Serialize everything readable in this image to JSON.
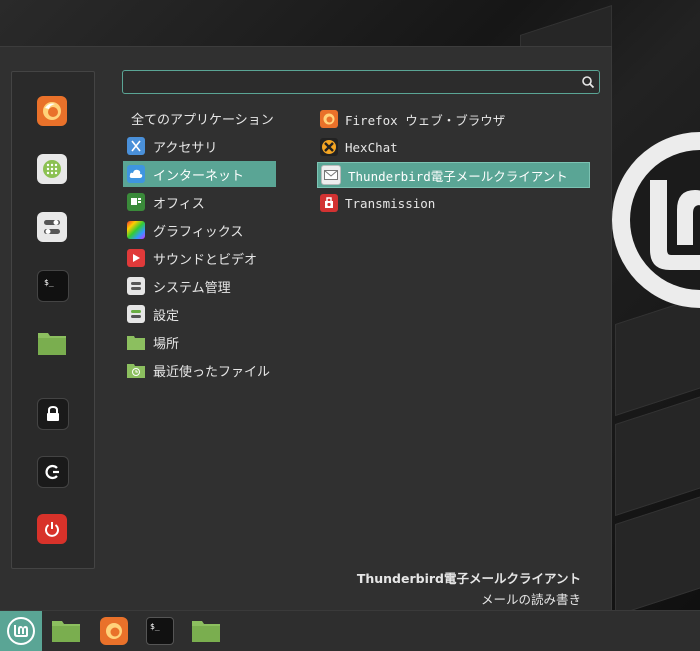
{
  "search": {
    "value": "",
    "placeholder": ""
  },
  "favorites": [
    {
      "name": "firefox-icon"
    },
    {
      "name": "software-manager-icon"
    },
    {
      "name": "system-settings-icon"
    },
    {
      "name": "terminal-icon"
    },
    {
      "name": "files-icon"
    },
    {
      "name": "lock-icon"
    },
    {
      "name": "logout-icon"
    },
    {
      "name": "shutdown-icon"
    }
  ],
  "categories": {
    "header": "全てのアプリケーション",
    "items": [
      {
        "label": "アクセサリ"
      },
      {
        "label": "インターネット",
        "selected": true
      },
      {
        "label": "オフィス"
      },
      {
        "label": "グラフィックス"
      },
      {
        "label": "サウンドとビデオ"
      },
      {
        "label": "システム管理"
      },
      {
        "label": "設定"
      },
      {
        "label": "場所"
      },
      {
        "label": "最近使ったファイル"
      }
    ]
  },
  "apps": [
    {
      "label": "Firefox ウェブ・ブラウザ"
    },
    {
      "label": "HexChat"
    },
    {
      "label": "Thunderbird電子メールクライアント",
      "selected": true
    },
    {
      "label": "Transmission"
    }
  ],
  "description": {
    "title": "Thunderbird電子メールクライアント",
    "subtitle": "メールの読み書き"
  },
  "colors": {
    "accent": "#5aa595",
    "menu_bg": "#303030",
    "panel_bg": "#2e2e2e"
  }
}
